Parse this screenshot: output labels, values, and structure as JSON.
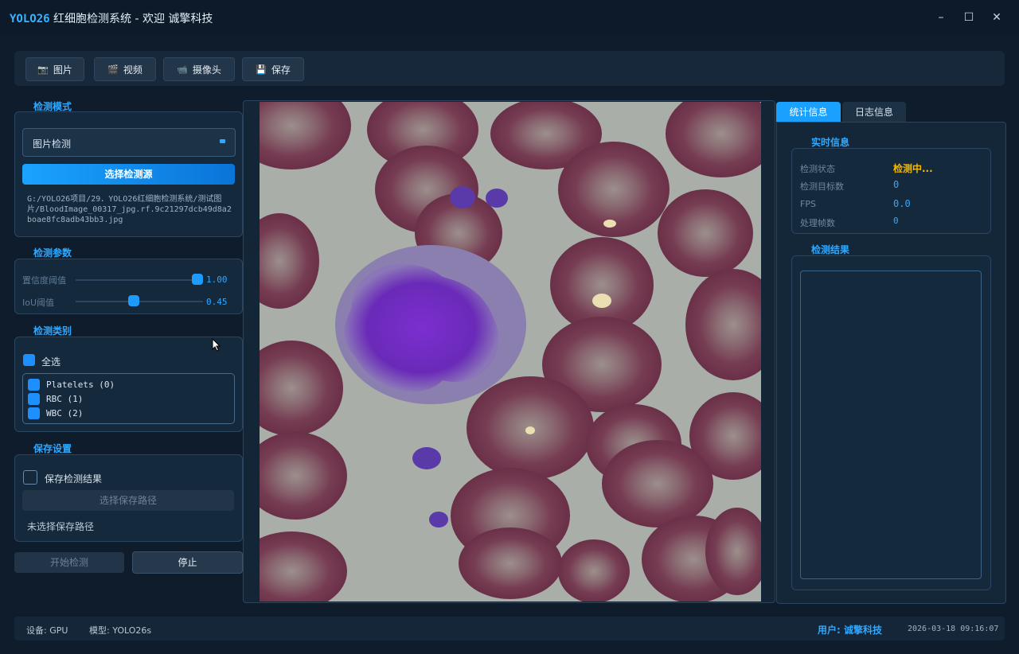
{
  "window": {
    "brand": "YOLO26",
    "title": "红细胞检测系统 - 欢迎 诚擎科技",
    "min_glyph": "–",
    "max_glyph": "☐",
    "close_glyph": "✕"
  },
  "toolbar": {
    "image": "图片",
    "video": "视频",
    "camera": "摄像头",
    "save": "保存"
  },
  "mode": {
    "title": "检测模式",
    "selected": "图片检测",
    "select_source": "选择检测源",
    "path": "G:/YOLO26项目/29．YOLO26红细胞检测系统/测试图片/BloodImage_00317_jpg.rf.9c21297dcb49d8a2boae8fc8adb43bb3.jpg"
  },
  "params": {
    "title": "检测参数",
    "conf_label": "置信度阈值",
    "conf_value": "1.00",
    "conf_level": 1.0,
    "iou_label": "IoU阈值",
    "iou_value": "0.45",
    "iou_level": 0.45
  },
  "classes": {
    "title": "检测类别",
    "select_all": "全选",
    "items": [
      "Platelets (0)",
      "RBC (1)",
      "WBC (2)"
    ]
  },
  "save_settings": {
    "title": "保存设置",
    "save_result": "保存检测结果",
    "choose_path": "选择保存路径",
    "no_path": "未选择保存路径"
  },
  "actions": {
    "start": "开始检测",
    "stop": "停止"
  },
  "tabs": {
    "stats": "统计信息",
    "log": "日志信息"
  },
  "realtime": {
    "title": "实时信息",
    "status_label": "检测状态",
    "status_value": "检测中...",
    "targets_label": "检测目标数",
    "targets_value": "0",
    "fps_label": "FPS",
    "fps_value": "0.0",
    "frames_label": "处理帧数",
    "frames_value": "0"
  },
  "results": {
    "title": "检测结果"
  },
  "statusbar": {
    "device": "设备: GPU",
    "model": "模型: YOLO26s",
    "user": "用户: 诚擎科技",
    "datetime": "2026-03-18 09:16:07"
  },
  "colors": {
    "accent": "#2fa8ff",
    "status_running": "#f5b800",
    "background": "#0e1c2c"
  },
  "icons": [
    "image-icon",
    "video-icon",
    "camera-icon",
    "save-icon",
    "mouse-cursor-icon"
  ]
}
